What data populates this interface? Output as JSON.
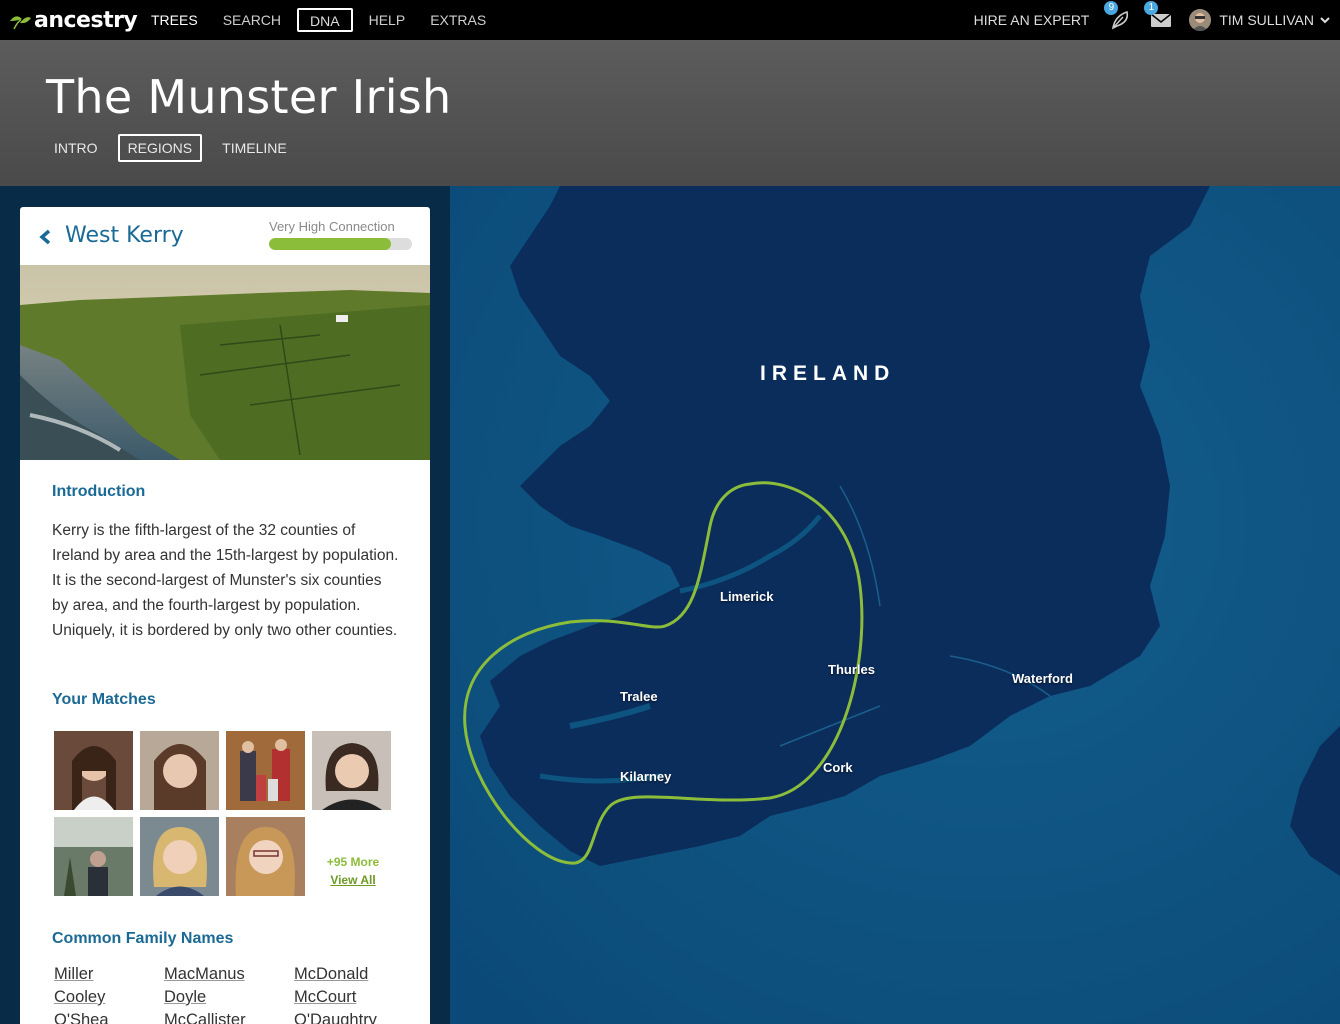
{
  "topbar": {
    "logo_text": "ancestry",
    "nav": [
      {
        "label": "TREES",
        "active": true
      },
      {
        "label": "SEARCH"
      },
      {
        "label": "DNA",
        "boxed": true
      },
      {
        "label": "HELP"
      },
      {
        "label": "EXTRAS"
      }
    ],
    "hire_label": "HIRE AN EXPERT",
    "hints_count": "9",
    "messages_count": "1",
    "user_name": "TIM SULLIVAN"
  },
  "header": {
    "title": "The Munster Irish",
    "tabs": [
      "INTRO",
      "REGIONS",
      "TIMELINE"
    ]
  },
  "panel": {
    "region": "West Kerry",
    "connection_label": "Very High Connection",
    "connection_level": 0.85,
    "intro_title": "Introduction",
    "intro_text": "Kerry is the fifth-largest of the 32 counties of Ireland by area and the 15th-largest by population. It is the second-largest of Munster's six counties by area, and the fourth-largest by population. Uniquely, it is bordered by only two other counties.",
    "matches_title": "Your Matches",
    "more_count": "+95 More",
    "view_all": "View All",
    "names_title": "Common Family Names",
    "names": [
      "Miller",
      "Cooley",
      "O'Shea",
      "MacManus",
      "Doyle",
      "McCallister",
      "McDonald",
      "McCourt",
      "O'Daughtry"
    ]
  },
  "map": {
    "country": "IRELAND",
    "cities": [
      "Limerick",
      "Thurles",
      "Waterford",
      "Tralee",
      "Kilarney",
      "Cork"
    ]
  },
  "colors": {
    "accent_green": "#8cbd3a",
    "link_blue": "#1b6a96",
    "sea": "#0e5480",
    "land": "#0b2d5c"
  }
}
